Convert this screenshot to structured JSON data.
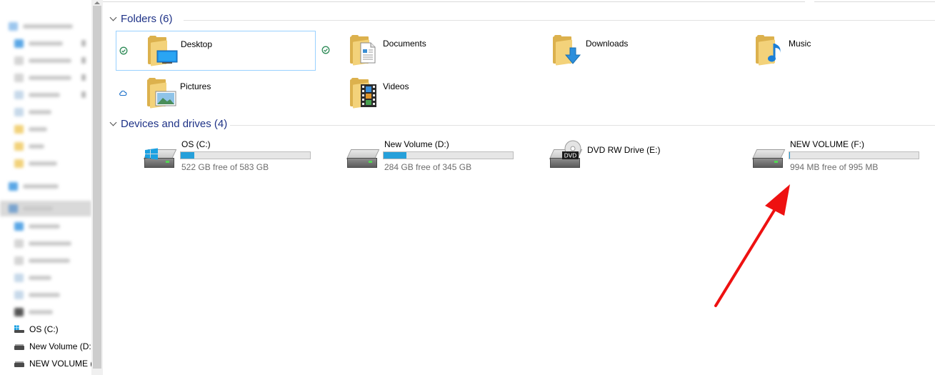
{
  "navigation": {
    "items": [
      {
        "label": "OS (C:)",
        "icon": "windows-drive-icon"
      },
      {
        "label": "New Volume (D:)",
        "icon": "drive-icon"
      },
      {
        "label": "NEW VOLUME (F:)",
        "icon": "drive-icon"
      }
    ]
  },
  "folders": {
    "title": "Folders (6)",
    "items": [
      {
        "name": "Desktop",
        "status": "synced-check-icon"
      },
      {
        "name": "Documents",
        "status": "synced-check-icon"
      },
      {
        "name": "Downloads",
        "status": ""
      },
      {
        "name": "Music",
        "status": ""
      },
      {
        "name": "Pictures",
        "status": "cloud-icon"
      },
      {
        "name": "Videos",
        "status": ""
      }
    ]
  },
  "devices": {
    "title": "Devices and drives (4)",
    "items": [
      {
        "name": "OS (C:)",
        "free": "522 GB free of 583 GB",
        "used_fraction": 0.105
      },
      {
        "name": "New Volume (D:)",
        "free": "284 GB free of 345 GB",
        "used_fraction": 0.177
      },
      {
        "name": "DVD RW Drive (E:)",
        "free": "",
        "used_fraction": null
      },
      {
        "name": "NEW VOLUME (F:)",
        "free": "994 MB free of 995 MB",
        "used_fraction": 0.001
      }
    ]
  },
  "annotation": {
    "color": "#ee1111",
    "icon": "red-arrow-annotation"
  },
  "colors": {
    "accent": "#26a0da",
    "group_title": "#1e3287",
    "selection_border": "#99d1ff",
    "sync_green": "#2e8b57",
    "cloud_blue": "#1a6fc9"
  }
}
